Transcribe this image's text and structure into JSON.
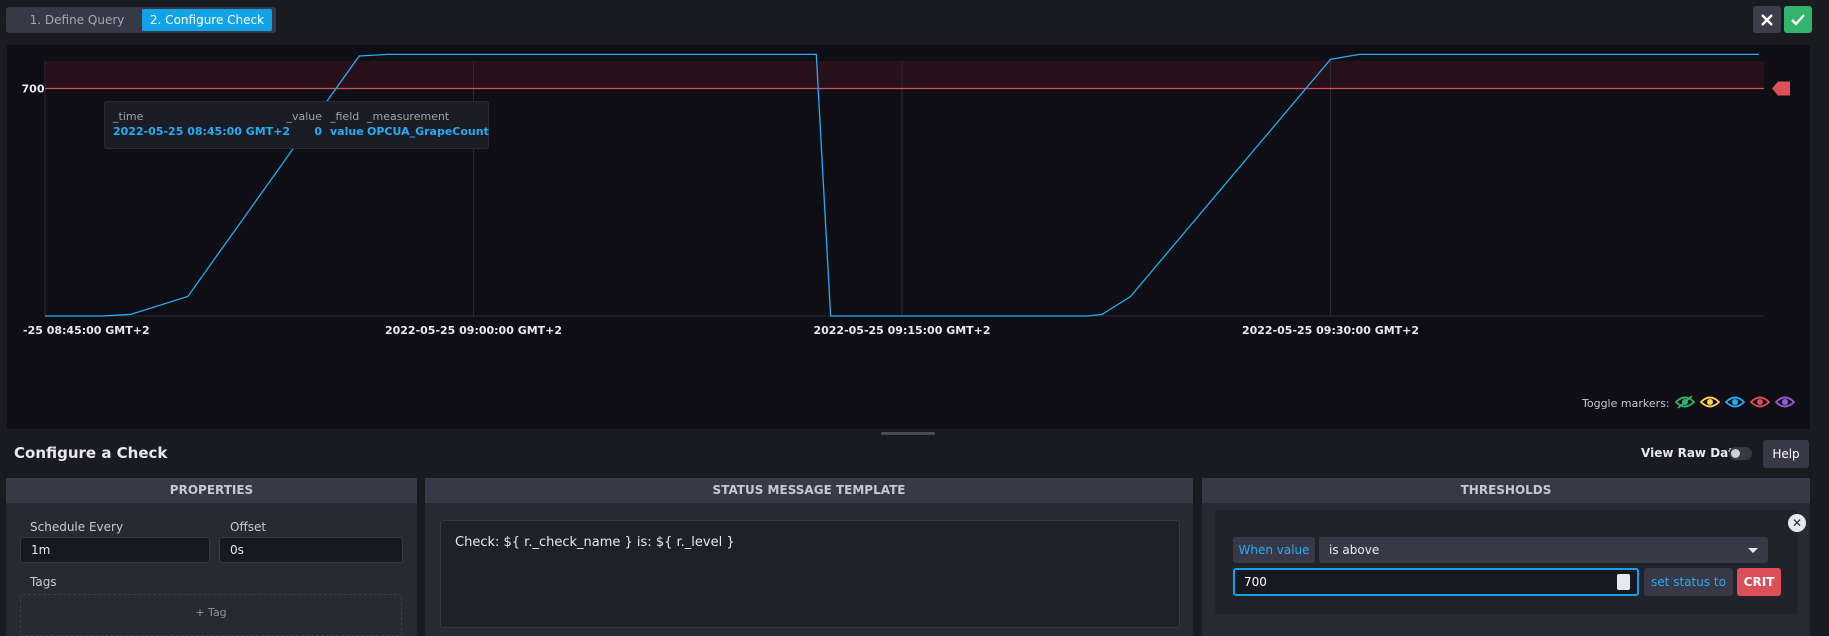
{
  "wizard": {
    "steps": [
      "1. Define Query",
      "2. Configure Check"
    ],
    "active_step": 2
  },
  "topbar": {
    "close_icon": "close-icon",
    "confirm_icon": "check-icon"
  },
  "chart_data": {
    "type": "line",
    "x_ticks": [
      "-25 08:45:00 GMT+2",
      "2022-05-25 09:00:00 GMT+2",
      "2022-05-25 09:15:00 GMT+2",
      "2022-05-25 09:30:00 GMT+2"
    ],
    "y_ticks": [
      "700"
    ],
    "threshold": {
      "value": 700,
      "color": "#dc4e58",
      "region": "above"
    },
    "series": [
      {
        "color": "#22adf6",
        "x_minutes_after_0845": [
          0,
          2,
          3,
          5,
          11,
          12,
          26,
          27,
          27.5,
          36,
          36.5,
          37,
          38,
          45,
          46,
          60
        ],
        "values": [
          0,
          0,
          5,
          60,
          800,
          805,
          805,
          805,
          0,
          0,
          0,
          5,
          60,
          790,
          805,
          805
        ]
      }
    ],
    "grid": true
  },
  "tooltip": {
    "columns": [
      {
        "header": "_time",
        "value": "2022-05-25 08:45:00 GMT+2"
      },
      {
        "header": "_value",
        "value": "0"
      },
      {
        "header": "_field",
        "value": "value"
      },
      {
        "header": "_measurement",
        "value": "OPCUA_GrapeCount"
      }
    ]
  },
  "markers": {
    "label": "Toggle markers:",
    "colors": [
      "#34b36c",
      "#ffd255",
      "#22adf6",
      "#dc4e58",
      "#9b59d6"
    ]
  },
  "configure": {
    "title": "Configure a Check",
    "raw_data_label": "View Raw Data",
    "help_label": "Help"
  },
  "properties": {
    "header": "PROPERTIES",
    "schedule_label": "Schedule Every",
    "schedule_value": "1m",
    "offset_label": "Offset",
    "offset_value": "0s",
    "tags_label": "Tags",
    "add_tag_label": "+ Tag"
  },
  "status_template": {
    "header": "STATUS MESSAGE TEMPLATE",
    "text": "Check: ${ r._check_name } is: ${ r._level }"
  },
  "thresholds": {
    "header": "THRESHOLDS",
    "when_label": "When value",
    "condition": "is above",
    "value": "700",
    "set_status_label": "set status to",
    "level": "CRIT"
  }
}
